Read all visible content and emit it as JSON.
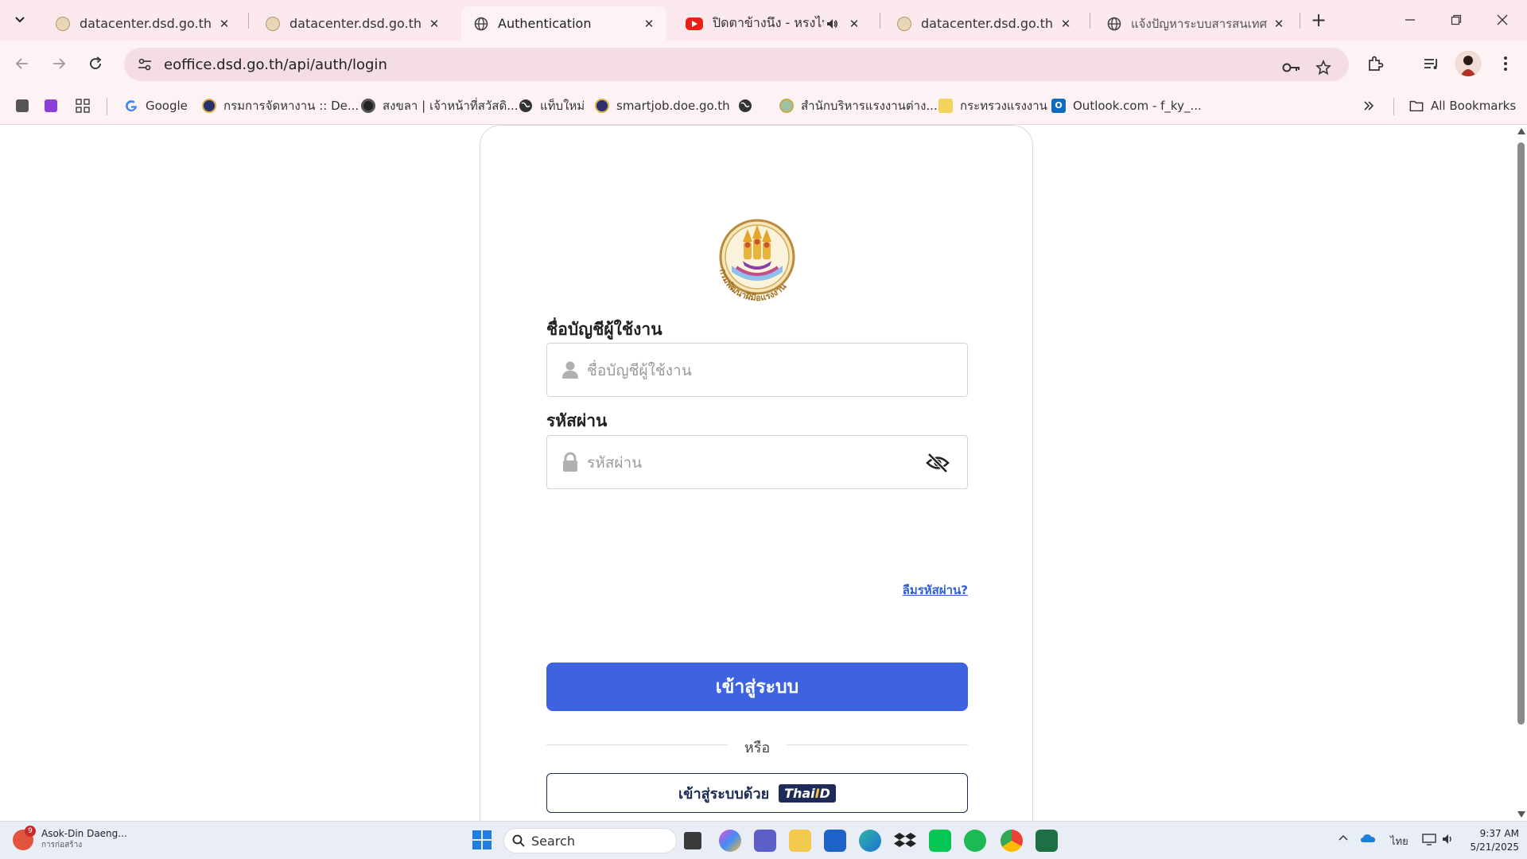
{
  "browser": {
    "tabs": [
      {
        "title": "datacenter.dsd.go.th |",
        "active": false,
        "favicon": "dsd-seal-icon"
      },
      {
        "title": "datacenter.dsd.go.th |",
        "active": false,
        "favicon": "dsd-seal-icon"
      },
      {
        "title": "Authentication",
        "active": true,
        "favicon": "globe-icon"
      },
      {
        "title": "ปิดตาข้างนึง - หรงไทย [",
        "active": false,
        "favicon": "youtube-icon"
      },
      {
        "title": "datacenter.dsd.go.th |",
        "active": false,
        "favicon": "dsd-seal-icon"
      },
      {
        "title": "แจ้งปัญหาระบบสารสนเทศ กร",
        "active": false,
        "favicon": "globe-icon"
      }
    ],
    "address_url": "eoffice.dsd.go.th/api/auth/login",
    "bookmarks": [
      {
        "label": "Google"
      },
      {
        "label": "กรมการจัดหางาน :: De..."
      },
      {
        "label": "สงขลา | เจ้าหน้าที่สวัสดิ..."
      },
      {
        "label": "แท็บใหม่"
      },
      {
        "label": "smartjob.doe.go.th"
      },
      {
        "label": "สำนักบริหารแรงงานต่าง..."
      },
      {
        "label": "กระทรวงแรงงาน"
      },
      {
        "label": "Outlook.com - f_ky_..."
      }
    ],
    "all_bookmarks_label": "All Bookmarks"
  },
  "login": {
    "username_label": "ชื่อบัญชีผู้ใช้งาน",
    "username_placeholder": "ชื่อบัญชีผู้ใช้งาน",
    "password_label": "รหัสผ่าน",
    "password_placeholder": "รหัสผ่าน",
    "forgot_label": "ลืมรหัสผ่าน?",
    "submit_label": "เข้าสู่ระบบ",
    "or_label": "หรือ",
    "thaid_label": "เข้าสู่ระบบด้วย",
    "thaid_logo_text_a": "Thai",
    "thaid_logo_text_b": "D",
    "thaid_logo_text_i": "I",
    "logo_text": "กรมพัฒนาฝีมือแรงงาน",
    "colors": {
      "primary": "#3e63e0",
      "thaid_navy": "#1e2b58"
    }
  },
  "taskbar": {
    "weather_title": "Asok-Din Daeng...",
    "weather_sub": "การก่อสร้าง",
    "weather_badge": "9",
    "search_label": "Search",
    "lang": "ไทย",
    "time": "9:37 AM",
    "date": "5/21/2025"
  }
}
